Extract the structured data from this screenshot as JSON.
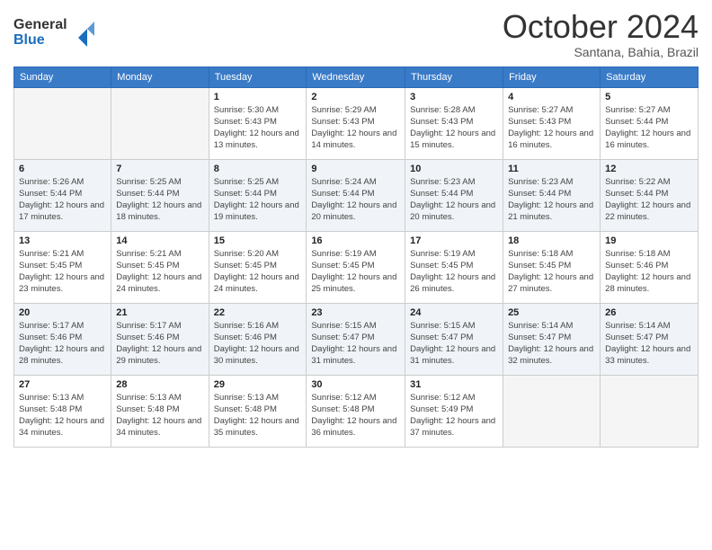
{
  "logo": {
    "line1": "General",
    "line2": "Blue"
  },
  "header": {
    "month": "October 2024",
    "location": "Santana, Bahia, Brazil"
  },
  "days_of_week": [
    "Sunday",
    "Monday",
    "Tuesday",
    "Wednesday",
    "Thursday",
    "Friday",
    "Saturday"
  ],
  "weeks": [
    [
      {
        "day": "",
        "sunrise": "",
        "sunset": "",
        "daylight": ""
      },
      {
        "day": "",
        "sunrise": "",
        "sunset": "",
        "daylight": ""
      },
      {
        "day": "1",
        "sunrise": "Sunrise: 5:30 AM",
        "sunset": "Sunset: 5:43 PM",
        "daylight": "Daylight: 12 hours and 13 minutes."
      },
      {
        "day": "2",
        "sunrise": "Sunrise: 5:29 AM",
        "sunset": "Sunset: 5:43 PM",
        "daylight": "Daylight: 12 hours and 14 minutes."
      },
      {
        "day": "3",
        "sunrise": "Sunrise: 5:28 AM",
        "sunset": "Sunset: 5:43 PM",
        "daylight": "Daylight: 12 hours and 15 minutes."
      },
      {
        "day": "4",
        "sunrise": "Sunrise: 5:27 AM",
        "sunset": "Sunset: 5:43 PM",
        "daylight": "Daylight: 12 hours and 16 minutes."
      },
      {
        "day": "5",
        "sunrise": "Sunrise: 5:27 AM",
        "sunset": "Sunset: 5:44 PM",
        "daylight": "Daylight: 12 hours and 16 minutes."
      }
    ],
    [
      {
        "day": "6",
        "sunrise": "Sunrise: 5:26 AM",
        "sunset": "Sunset: 5:44 PM",
        "daylight": "Daylight: 12 hours and 17 minutes."
      },
      {
        "day": "7",
        "sunrise": "Sunrise: 5:25 AM",
        "sunset": "Sunset: 5:44 PM",
        "daylight": "Daylight: 12 hours and 18 minutes."
      },
      {
        "day": "8",
        "sunrise": "Sunrise: 5:25 AM",
        "sunset": "Sunset: 5:44 PM",
        "daylight": "Daylight: 12 hours and 19 minutes."
      },
      {
        "day": "9",
        "sunrise": "Sunrise: 5:24 AM",
        "sunset": "Sunset: 5:44 PM",
        "daylight": "Daylight: 12 hours and 20 minutes."
      },
      {
        "day": "10",
        "sunrise": "Sunrise: 5:23 AM",
        "sunset": "Sunset: 5:44 PM",
        "daylight": "Daylight: 12 hours and 20 minutes."
      },
      {
        "day": "11",
        "sunrise": "Sunrise: 5:23 AM",
        "sunset": "Sunset: 5:44 PM",
        "daylight": "Daylight: 12 hours and 21 minutes."
      },
      {
        "day": "12",
        "sunrise": "Sunrise: 5:22 AM",
        "sunset": "Sunset: 5:44 PM",
        "daylight": "Daylight: 12 hours and 22 minutes."
      }
    ],
    [
      {
        "day": "13",
        "sunrise": "Sunrise: 5:21 AM",
        "sunset": "Sunset: 5:45 PM",
        "daylight": "Daylight: 12 hours and 23 minutes."
      },
      {
        "day": "14",
        "sunrise": "Sunrise: 5:21 AM",
        "sunset": "Sunset: 5:45 PM",
        "daylight": "Daylight: 12 hours and 24 minutes."
      },
      {
        "day": "15",
        "sunrise": "Sunrise: 5:20 AM",
        "sunset": "Sunset: 5:45 PM",
        "daylight": "Daylight: 12 hours and 24 minutes."
      },
      {
        "day": "16",
        "sunrise": "Sunrise: 5:19 AM",
        "sunset": "Sunset: 5:45 PM",
        "daylight": "Daylight: 12 hours and 25 minutes."
      },
      {
        "day": "17",
        "sunrise": "Sunrise: 5:19 AM",
        "sunset": "Sunset: 5:45 PM",
        "daylight": "Daylight: 12 hours and 26 minutes."
      },
      {
        "day": "18",
        "sunrise": "Sunrise: 5:18 AM",
        "sunset": "Sunset: 5:45 PM",
        "daylight": "Daylight: 12 hours and 27 minutes."
      },
      {
        "day": "19",
        "sunrise": "Sunrise: 5:18 AM",
        "sunset": "Sunset: 5:46 PM",
        "daylight": "Daylight: 12 hours and 28 minutes."
      }
    ],
    [
      {
        "day": "20",
        "sunrise": "Sunrise: 5:17 AM",
        "sunset": "Sunset: 5:46 PM",
        "daylight": "Daylight: 12 hours and 28 minutes."
      },
      {
        "day": "21",
        "sunrise": "Sunrise: 5:17 AM",
        "sunset": "Sunset: 5:46 PM",
        "daylight": "Daylight: 12 hours and 29 minutes."
      },
      {
        "day": "22",
        "sunrise": "Sunrise: 5:16 AM",
        "sunset": "Sunset: 5:46 PM",
        "daylight": "Daylight: 12 hours and 30 minutes."
      },
      {
        "day": "23",
        "sunrise": "Sunrise: 5:15 AM",
        "sunset": "Sunset: 5:47 PM",
        "daylight": "Daylight: 12 hours and 31 minutes."
      },
      {
        "day": "24",
        "sunrise": "Sunrise: 5:15 AM",
        "sunset": "Sunset: 5:47 PM",
        "daylight": "Daylight: 12 hours and 31 minutes."
      },
      {
        "day": "25",
        "sunrise": "Sunrise: 5:14 AM",
        "sunset": "Sunset: 5:47 PM",
        "daylight": "Daylight: 12 hours and 32 minutes."
      },
      {
        "day": "26",
        "sunrise": "Sunrise: 5:14 AM",
        "sunset": "Sunset: 5:47 PM",
        "daylight": "Daylight: 12 hours and 33 minutes."
      }
    ],
    [
      {
        "day": "27",
        "sunrise": "Sunrise: 5:13 AM",
        "sunset": "Sunset: 5:48 PM",
        "daylight": "Daylight: 12 hours and 34 minutes."
      },
      {
        "day": "28",
        "sunrise": "Sunrise: 5:13 AM",
        "sunset": "Sunset: 5:48 PM",
        "daylight": "Daylight: 12 hours and 34 minutes."
      },
      {
        "day": "29",
        "sunrise": "Sunrise: 5:13 AM",
        "sunset": "Sunset: 5:48 PM",
        "daylight": "Daylight: 12 hours and 35 minutes."
      },
      {
        "day": "30",
        "sunrise": "Sunrise: 5:12 AM",
        "sunset": "Sunset: 5:48 PM",
        "daylight": "Daylight: 12 hours and 36 minutes."
      },
      {
        "day": "31",
        "sunrise": "Sunrise: 5:12 AM",
        "sunset": "Sunset: 5:49 PM",
        "daylight": "Daylight: 12 hours and 37 minutes."
      },
      {
        "day": "",
        "sunrise": "",
        "sunset": "",
        "daylight": ""
      },
      {
        "day": "",
        "sunrise": "",
        "sunset": "",
        "daylight": ""
      }
    ]
  ]
}
